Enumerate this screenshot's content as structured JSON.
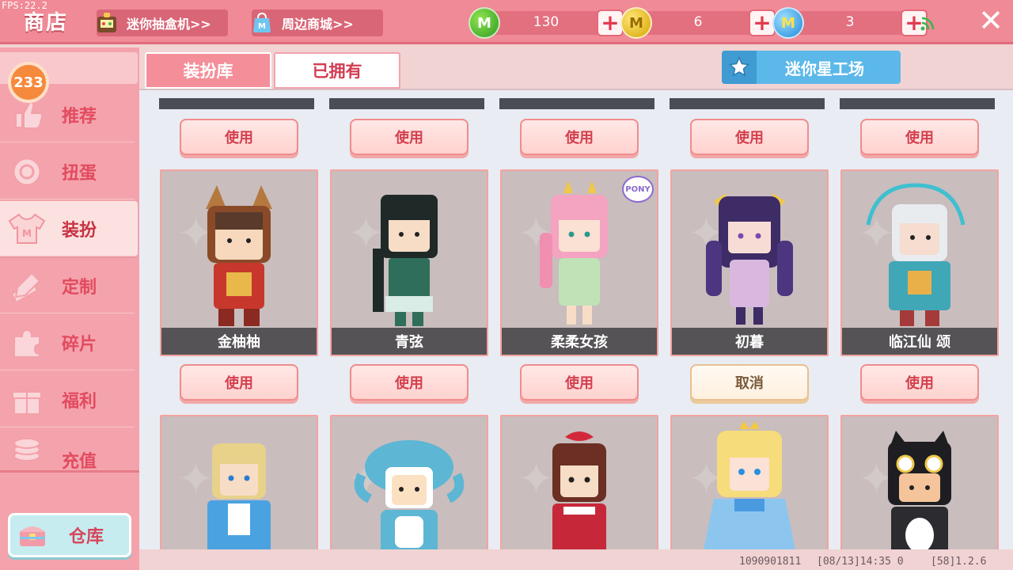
{
  "fps": "FPS:22.2",
  "header": {
    "title": "商店",
    "gacha_link": "迷你抽盒机>>",
    "mall_link": "周边商城>>",
    "currencies": [
      {
        "name": "green-gem",
        "value": "130",
        "color": "#3aa52a"
      },
      {
        "name": "gold-coin",
        "value": "6",
        "color": "#e6b800"
      },
      {
        "name": "mini-coin",
        "value": "3",
        "color": "#2a8fe0"
      }
    ]
  },
  "sidebar": {
    "badge": "233",
    "items": [
      {
        "label": "推荐",
        "icon": "thumbs-up-icon"
      },
      {
        "label": "扭蛋",
        "icon": "capsule-icon"
      },
      {
        "label": "装扮",
        "icon": "shirt-icon"
      },
      {
        "label": "定制",
        "icon": "pencil-ruler-icon"
      },
      {
        "label": "碎片",
        "icon": "puzzle-icon"
      },
      {
        "label": "福利",
        "icon": "gift-icon"
      },
      {
        "label": "充值",
        "icon": "coins-icon"
      }
    ],
    "warehouse": "仓库"
  },
  "tabs": {
    "wardrobe": "装扮库",
    "owned": "已拥有"
  },
  "workshop": "迷你星工场",
  "buttons": {
    "use": "使用",
    "cancel": "取消"
  },
  "top_row_cards": [
    {
      "button": "使用"
    },
    {
      "button": "使用"
    },
    {
      "button": "使用"
    },
    {
      "button": "使用"
    },
    {
      "button": "使用"
    }
  ],
  "cards": [
    {
      "name": "金柚柚",
      "button": "使用",
      "hair": "#5a3a2a",
      "outfit": "#c8372c"
    },
    {
      "name": "青弦",
      "button": "使用",
      "hair": "#1f2a28",
      "outfit": "#2f6e5a"
    },
    {
      "name": "柔柔女孩",
      "button": "使用",
      "hair": "#f4a3c0",
      "outfit": "#bfe3b6",
      "tag": "PONY"
    },
    {
      "name": "初暮",
      "button": "取消",
      "hair": "#3d2c66",
      "outfit": "#d9b8e0"
    },
    {
      "name": "临江仙 颂",
      "button": "使用",
      "hair": "#e8ecef",
      "outfit": "#3fa7b6"
    }
  ],
  "bottom_cards": [
    {
      "hair": "#e8d28a",
      "outfit": "#4aa3e0"
    },
    {
      "hair": "#5cb6d4",
      "outfit": "#5cb6d4"
    },
    {
      "hair": "#6b2f23",
      "outfit": "#c6283a"
    },
    {
      "hair": "#f6dc7a",
      "outfit": "#8cc6ef"
    },
    {
      "hair": "#1e1e22",
      "outfit": "#2b2b30"
    }
  ],
  "footer": {
    "uid": "1090901811",
    "time": "[08/13]14:35 0",
    "version": "[58]1.2.6"
  }
}
